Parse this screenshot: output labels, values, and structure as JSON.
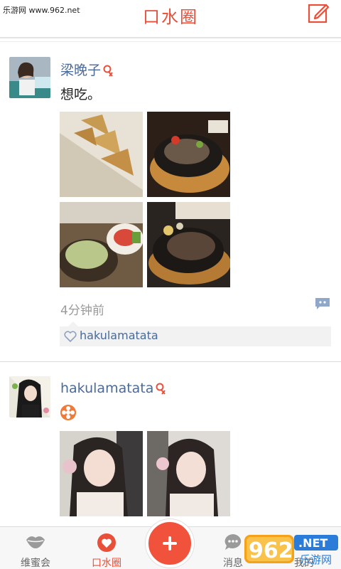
{
  "watermark": "乐游网 www.962.net",
  "header": {
    "title": "口水圈"
  },
  "posts": [
    {
      "username": "梁晚子",
      "text": "想吃。",
      "time": "4分钟前",
      "likes": [
        "hakulamatata"
      ],
      "photos": [
        "samosa-photo",
        "steak-plate-photo",
        "salad-photo",
        "steak-plate-photo-2"
      ]
    },
    {
      "username": "hakulamatata",
      "photos": [
        "portrait-photo",
        "portrait-photo-2"
      ]
    }
  ],
  "nav": {
    "items": [
      {
        "label": "维蜜会",
        "icon": "lips-icon"
      },
      {
        "label": "口水圈",
        "icon": "heart-icon"
      },
      {
        "label": "消息",
        "icon": "chat-icon"
      },
      {
        "label": "我的",
        "icon": "user-icon"
      }
    ]
  },
  "brand_logo": {
    "text": "962",
    "net": ".NET",
    "sub": "乐游网"
  },
  "colors": {
    "accent": "#e8503a",
    "link": "#4a6a9a"
  }
}
